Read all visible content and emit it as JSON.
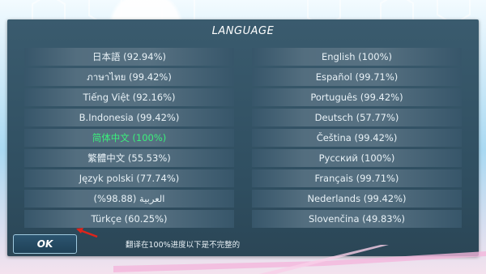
{
  "dialog": {
    "title": "LANGUAGE",
    "languages": [
      [
        "日本語 (92.94%)",
        "English (100%)"
      ],
      [
        "ภาษาไทย (99.42%)",
        "Español (99.71%)"
      ],
      [
        "Tiếng Việt (92.16%)",
        "Português (99.42%)"
      ],
      [
        "B.Indonesia (99.42%)",
        "Deutsch (57.77%)"
      ],
      [
        "简体中文 (100%)",
        "Čeština (99.42%)"
      ],
      [
        "繁體中文 (55.53%)",
        "Русский (100%)"
      ],
      [
        "Język polski (77.74%)",
        "Français (99.71%)"
      ],
      [
        "العربية (98.88%)",
        "Nederlands (99.42%)"
      ],
      [
        "Türkçe (60.25%)",
        "Slovenčina (49.83%)"
      ]
    ],
    "selected": "简体中文 (100%)",
    "ok_label": "OK",
    "hint": "翻译在100%进度以下是不完整的"
  },
  "colors": {
    "panel": "#2f4e60",
    "selected_text": "#3bf07b",
    "annotation_red": "#e0241b"
  }
}
